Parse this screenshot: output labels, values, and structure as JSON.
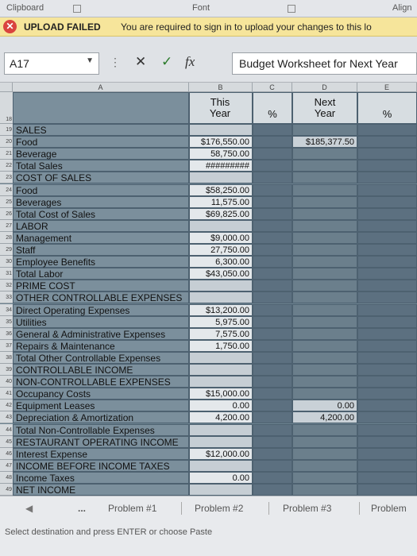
{
  "ribbon": {
    "clipboard": "Clipboard",
    "font": "Font",
    "align": "Align"
  },
  "message_bar": {
    "title": "UPLOAD FAILED",
    "text": "You are required to sign in to upload your changes to this lo"
  },
  "formula_bar": {
    "name_box": "A17",
    "formula": "Budget Worksheet for Next Year"
  },
  "columns": [
    "A",
    "B",
    "C",
    "D",
    "E"
  ],
  "header_row": {
    "row": "18",
    "b": "This Year",
    "c": "%",
    "d": "Next Year",
    "e": "%"
  },
  "rows": [
    {
      "num": "19",
      "label": "SALES",
      "b": "",
      "d": ""
    },
    {
      "num": "20",
      "label": "Food",
      "b": "$176,550.00",
      "d": "$185,377.50"
    },
    {
      "num": "21",
      "label": "Beverage",
      "b": "58,750.00",
      "d": ""
    },
    {
      "num": "22",
      "label": "Total Sales",
      "b": "#########",
      "d": ""
    },
    {
      "num": "23",
      "label": "COST OF SALES",
      "b": "",
      "d": ""
    },
    {
      "num": "24",
      "label": "Food",
      "b": "$58,250.00",
      "d": ""
    },
    {
      "num": "25",
      "label": "Beverages",
      "b": "11,575.00",
      "d": ""
    },
    {
      "num": "26",
      "label": "Total Cost of Sales",
      "b": "$69,825.00",
      "d": ""
    },
    {
      "num": "27",
      "label": "LABOR",
      "b": "",
      "d": ""
    },
    {
      "num": "28",
      "label": "Management",
      "b": "$9,000.00",
      "d": ""
    },
    {
      "num": "29",
      "label": "Staff",
      "b": "27,750.00",
      "d": ""
    },
    {
      "num": "30",
      "label": "Employee Benefits",
      "b": "6,300.00",
      "d": ""
    },
    {
      "num": "31",
      "label": "Total Labor",
      "b": "$43,050.00",
      "d": ""
    },
    {
      "num": "32",
      "label": "PRIME COST",
      "b": "",
      "d": ""
    },
    {
      "num": "33",
      "label": "OTHER CONTROLLABLE EXPENSES",
      "b": "",
      "d": ""
    },
    {
      "num": "34",
      "label": "Direct Operating Expenses",
      "b": "$13,200.00",
      "d": ""
    },
    {
      "num": "35",
      "label": "Utilities",
      "b": "5,975.00",
      "d": ""
    },
    {
      "num": "36",
      "label": "General & Administrative Expenses",
      "b": "7,575.00",
      "d": ""
    },
    {
      "num": "37",
      "label": "Repairs & Maintenance",
      "b": "1,750.00",
      "d": ""
    },
    {
      "num": "38",
      "label": "Total Other Controllable Expenses",
      "b": "",
      "d": ""
    },
    {
      "num": "39",
      "label": "CONTROLLABLE INCOME",
      "b": "",
      "d": ""
    },
    {
      "num": "40",
      "label": "NON-CONTROLLABLE EXPENSES",
      "b": "",
      "d": ""
    },
    {
      "num": "41",
      "label": "Occupancy Costs",
      "b": "$15,000.00",
      "d": ""
    },
    {
      "num": "42",
      "label": "Equipment Leases",
      "b": "0.00",
      "d": "0.00"
    },
    {
      "num": "43",
      "label": "Depreciation & Amortization",
      "b": "4,200.00",
      "d": "4,200.00"
    },
    {
      "num": "44",
      "label": "Total Non-Controllable Expenses",
      "b": "",
      "d": ""
    },
    {
      "num": "45",
      "label": "RESTAURANT OPERATING INCOME",
      "b": "",
      "d": ""
    },
    {
      "num": "46",
      "label": "Interest Expense",
      "b": "$12,000.00",
      "d": ""
    },
    {
      "num": "47",
      "label": "INCOME BEFORE INCOME TAXES",
      "b": "",
      "d": ""
    },
    {
      "num": "48",
      "label": "Income Taxes",
      "b": "0.00",
      "d": ""
    },
    {
      "num": "49",
      "label": "NET INCOME",
      "b": "",
      "d": ""
    }
  ],
  "sheet_tabs": {
    "more": "...",
    "tab1": "Problem #1",
    "tab2": "Problem #2",
    "tab3": "Problem #3",
    "tab4": "Problem"
  },
  "status": {
    "text": "Select destination and press ENTER or choose Paste"
  }
}
